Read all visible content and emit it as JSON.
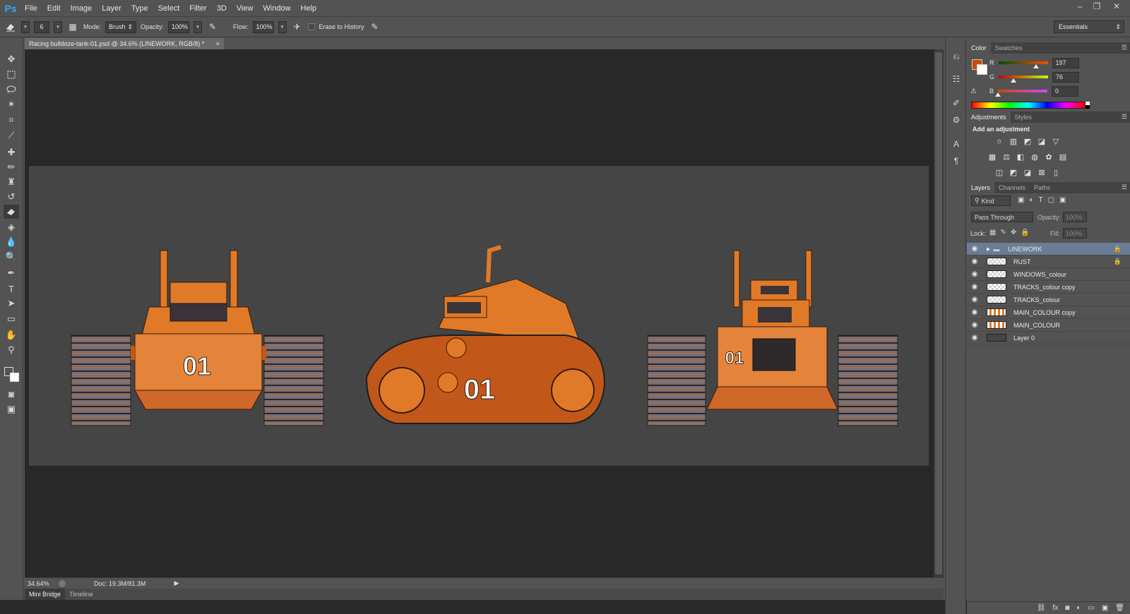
{
  "app": {
    "logo": "Ps"
  },
  "menu": [
    "File",
    "Edit",
    "Image",
    "Layer",
    "Type",
    "Select",
    "Filter",
    "3D",
    "View",
    "Window",
    "Help"
  ],
  "window_controls": {
    "minimize": "–",
    "restore": "❐",
    "close": "✕"
  },
  "options": {
    "brush_size": "6",
    "mode_label": "Mode:",
    "mode_value": "Brush",
    "opacity_label": "Opacity:",
    "opacity_value": "100%",
    "flow_label": "Flow:",
    "flow_value": "100%",
    "erase_history": "Erase to History",
    "workspace": "Essentials"
  },
  "document": {
    "tab_title": "Racing bulldoze-tank-01.psd @ 34.6% (LINEWORK, RGB/8) *",
    "close": "×"
  },
  "status": {
    "zoom": "34.64%",
    "doc": "Doc: 19.3M/81.3M"
  },
  "bottom_tabs": [
    "Mini Bridge",
    "Timeline"
  ],
  "tank": {
    "number": "01",
    "body_color": "#e07a28",
    "dark_color": "#c2571a",
    "track_color": "#7a7178"
  },
  "color_panel": {
    "tabs": [
      "Color",
      "Swatches"
    ],
    "foreground": "#c54c00",
    "r_label": "R",
    "r_value": "197",
    "r_fraction": 0.77,
    "g_label": "G",
    "g_value": "76",
    "g_fraction": 0.3,
    "b_label": "B",
    "b_value": "0",
    "b_fraction": 0.0
  },
  "adjustments_panel": {
    "tabs": [
      "Adjustments",
      "Styles"
    ],
    "heading": "Add an adjustment",
    "icons": [
      "brightness-icon",
      "levels-icon",
      "curves-icon",
      "exposure-icon",
      "vibrance-icon",
      "hue-saturation-icon",
      "color-balance-icon",
      "black-white-icon",
      "photo-filter-icon",
      "channel-mixer-icon",
      "color-lookup-icon",
      "invert-icon",
      "posterize-icon",
      "threshold-icon",
      "selective-color-icon",
      "gradient-map-icon"
    ]
  },
  "layers_panel": {
    "tabs": [
      "Layers",
      "Channels",
      "Paths"
    ],
    "filter_kind": "Kind",
    "blend_mode": "Pass Through",
    "opacity_label": "Opacity:",
    "opacity_value": "100%",
    "lock_label": "Lock:",
    "fill_label": "Fill:",
    "fill_value": "100%",
    "layers": [
      {
        "name": "LINEWORK",
        "type": "group",
        "locked": true,
        "selected": true
      },
      {
        "name": "RUST",
        "type": "layer",
        "locked": true,
        "selected": false
      },
      {
        "name": "WINDOWS_colour",
        "type": "layer",
        "locked": false,
        "selected": false
      },
      {
        "name": "TRACKS_colour copy",
        "type": "layer",
        "locked": false,
        "selected": false
      },
      {
        "name": "TRACKS_colour",
        "type": "layer",
        "locked": false,
        "selected": false
      },
      {
        "name": "MAIN_COLOUR copy",
        "type": "layer",
        "locked": false,
        "selected": false
      },
      {
        "name": "MAIN_COLOUR",
        "type": "layer",
        "locked": false,
        "selected": false
      },
      {
        "name": "Layer 0",
        "type": "layer",
        "locked": false,
        "selected": false
      }
    ]
  }
}
